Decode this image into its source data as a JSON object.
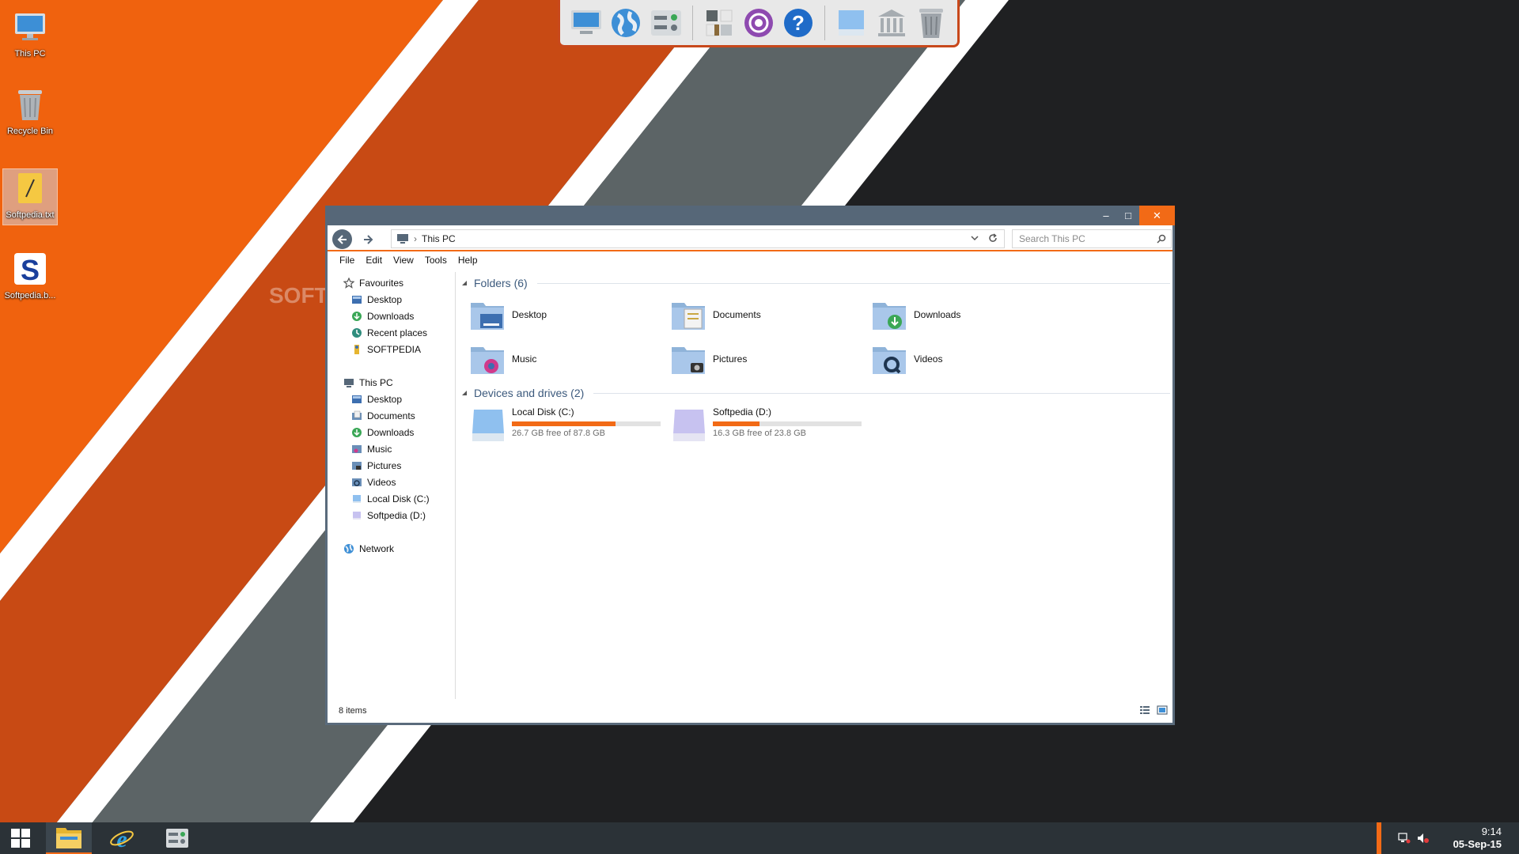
{
  "desktop": {
    "icons": [
      {
        "label": "This PC",
        "icon": "computer-icon"
      },
      {
        "label": "Recycle Bin",
        "icon": "recycle-bin-icon"
      },
      {
        "label": "Softpedia.txt",
        "icon": "text-file-icon",
        "selected": true
      },
      {
        "label": "Softpedia.b...",
        "icon": "softpedia-shortcut-icon"
      }
    ],
    "watermark": "SOFT"
  },
  "dock": {
    "items": [
      "monitor-icon",
      "globe-icon",
      "control-panel-icon",
      "home-icon",
      "settings-icon",
      "help-icon",
      "drive-icon",
      "library-icon",
      "trash-icon"
    ]
  },
  "window": {
    "titlebar_buttons": {
      "minimize": "–",
      "maximize": "□",
      "close": "✕"
    },
    "address": {
      "location": "This PC",
      "breadcrumb_sep": "›"
    },
    "search": {
      "placeholder": "Search This PC"
    },
    "menu": [
      "File",
      "Edit",
      "View",
      "Tools",
      "Help"
    ],
    "nav": {
      "favourites_label": "Favourites",
      "favourites": [
        "Desktop",
        "Downloads",
        "Recent places",
        "SOFTPEDIA"
      ],
      "thispc_label": "This PC",
      "thispc": [
        "Desktop",
        "Documents",
        "Downloads",
        "Music",
        "Pictures",
        "Videos",
        "Local Disk (C:)",
        "Softpedia (D:)"
      ],
      "network_label": "Network"
    },
    "folders": {
      "heading": "Folders (6)",
      "items": [
        "Desktop",
        "Documents",
        "Downloads",
        "Music",
        "Pictures",
        "Videos"
      ]
    },
    "drives": {
      "heading": "Devices and drives (2)",
      "items": [
        {
          "name": "Local Disk (C:)",
          "free": "26.7 GB free of 87.8 GB",
          "used_fraction": 0.696
        },
        {
          "name": "Softpedia (D:)",
          "free": "16.3 GB free of 23.8 GB",
          "used_fraction": 0.315
        }
      ]
    },
    "status": "8 items"
  },
  "taskbar": {
    "clock_time": "9:14",
    "clock_date": "05-Sep-15"
  },
  "colors": {
    "accent": "#f26a16",
    "titlebar": "#566778",
    "taskbar": "#2b3237"
  }
}
